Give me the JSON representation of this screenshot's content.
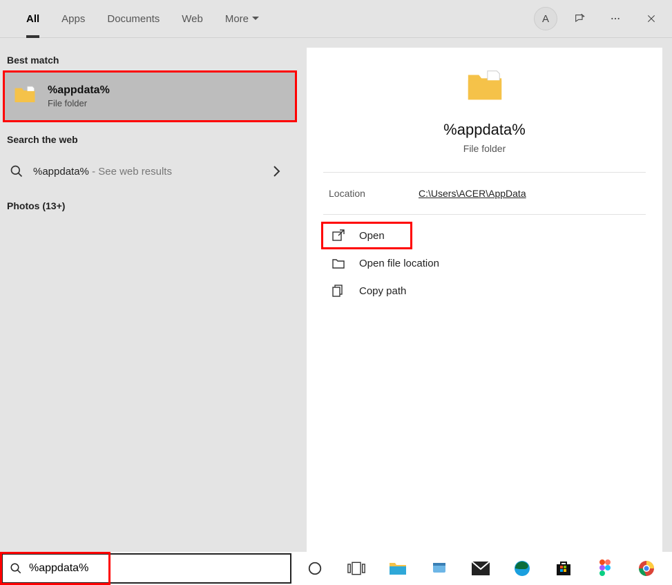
{
  "tabs": {
    "all": "All",
    "apps": "Apps",
    "documents": "Documents",
    "web": "Web",
    "more": "More"
  },
  "avatar_letter": "A",
  "left": {
    "best_match_header": "Best match",
    "result_title": "%appdata%",
    "result_sub": "File folder",
    "web_header": "Search the web",
    "web_text": "%appdata%",
    "web_sub": " - See web results",
    "photos": "Photos (13+)"
  },
  "panel": {
    "title": "%appdata%",
    "sub": "File folder",
    "location_label": "Location",
    "location_value": "C:\\Users\\ACER\\AppData",
    "open": "Open",
    "open_location": "Open file location",
    "copy_path": "Copy path"
  },
  "search_value": "%appdata%"
}
